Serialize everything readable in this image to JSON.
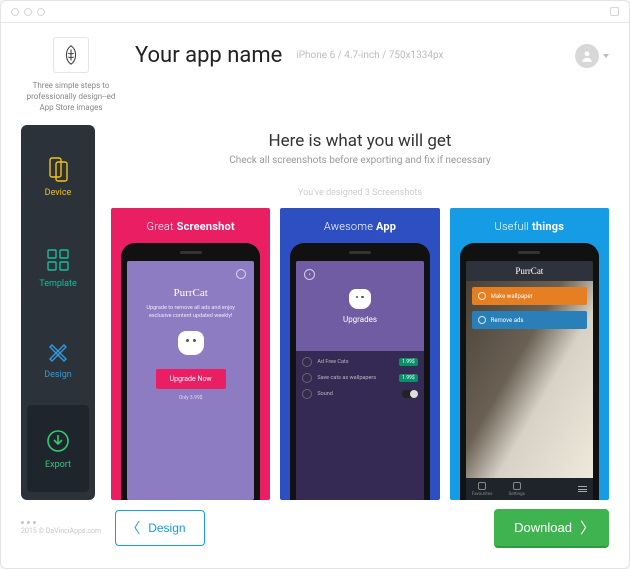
{
  "window": {
    "title": ""
  },
  "branding": {
    "tagline": "Three simple steps to professionally design--ed App Store images"
  },
  "header": {
    "app_name": "Your app name",
    "device_info": "iPhone 6 / 4.7-inch / 750x1334px"
  },
  "sidebar": {
    "items": [
      {
        "id": "device",
        "label": "Device"
      },
      {
        "id": "template",
        "label": "Template"
      },
      {
        "id": "design",
        "label": "Design"
      },
      {
        "id": "export",
        "label": "Export"
      }
    ],
    "active_id": "export"
  },
  "content": {
    "headline": "Here is what you will get",
    "subline": "Check all screenshots before exporting and fix if necessary",
    "count_line": "You've designed 3 Screenshots"
  },
  "screenshots": [
    {
      "caption_light": "Great ",
      "caption_bold": "Screenshot",
      "bg": "#e91e63",
      "mock": {
        "brand": "PurrCat",
        "desc": "Upgrade to remove all ads and enjoy exclusive content updated weekly!",
        "cta": "Upgrade Now",
        "price": "Only 3.99$"
      }
    },
    {
      "caption_light": "Awesome ",
      "caption_bold": "App",
      "bg": "#2e4fc2",
      "mock": {
        "title": "Upgrades",
        "rows": [
          {
            "label": "Ad Free Cats",
            "tag": "1.99$"
          },
          {
            "label": "Save cats as wallpapers",
            "tag": "1.99$"
          },
          {
            "label": "Sound",
            "toggle": true
          }
        ]
      }
    },
    {
      "caption_light": "Usefull ",
      "caption_bold": "things",
      "bg": "#159ce4",
      "mock": {
        "brand": "PurrCat",
        "pill1": "Make wallpaper",
        "pill2": "Remove ads",
        "tabs": [
          "Favourites",
          "Settings"
        ]
      }
    }
  ],
  "footer": {
    "copyright": "2015 © DaVinciApps.com",
    "back_label": "Design",
    "download_label": "Download"
  },
  "colors": {
    "accent_blue": "#159ce4",
    "accent_green": "#3fb34f"
  }
}
